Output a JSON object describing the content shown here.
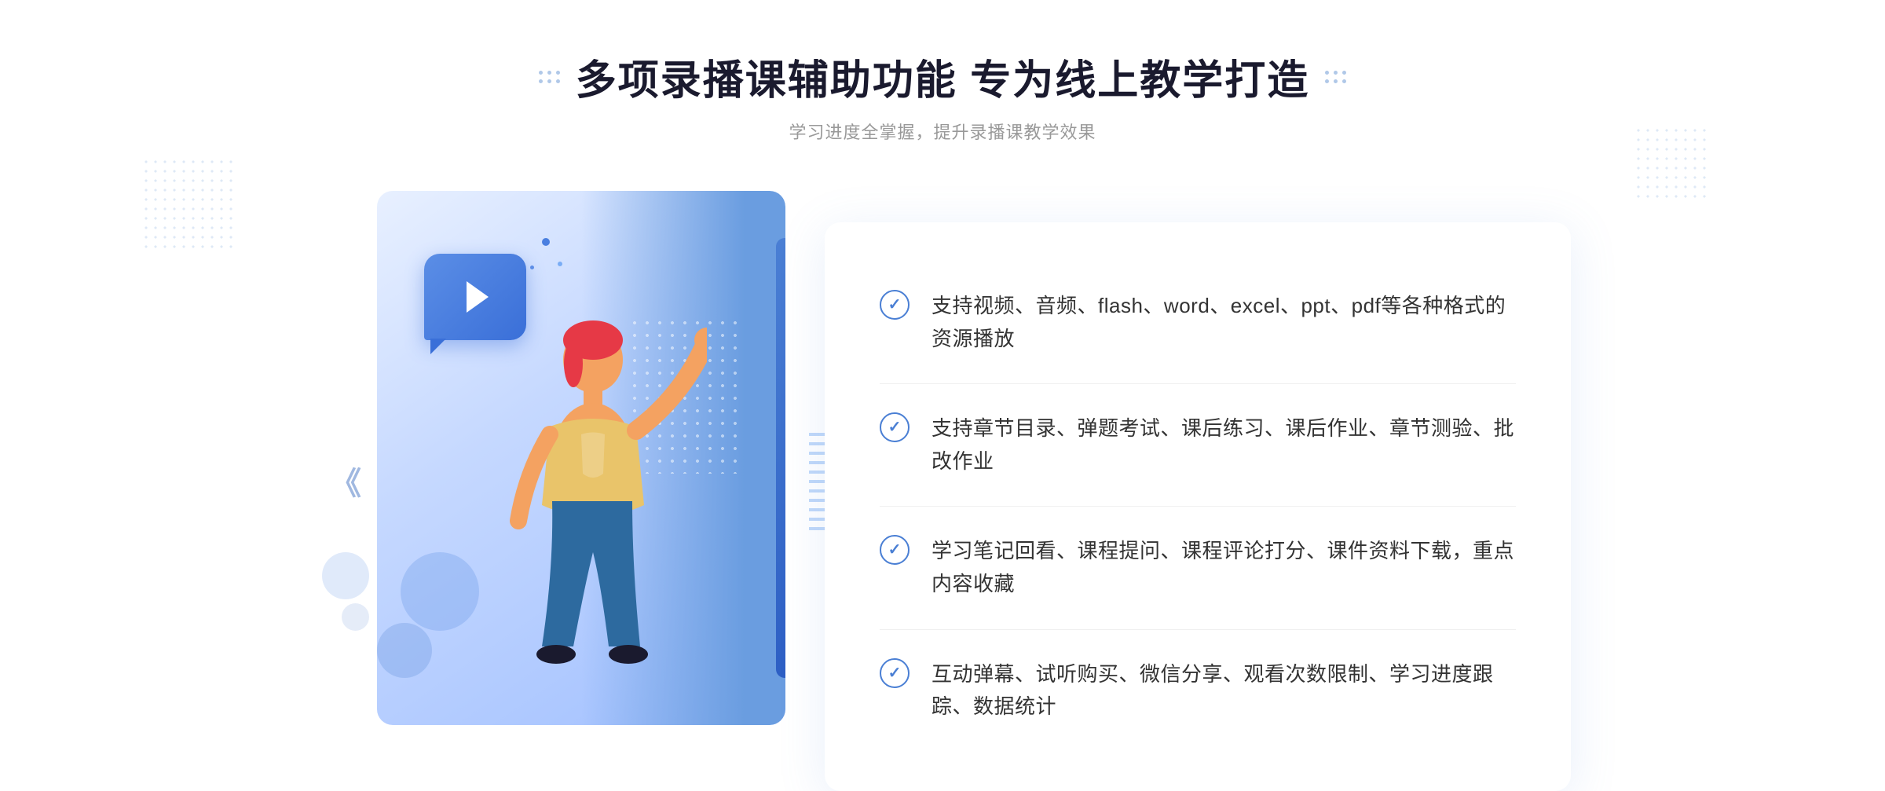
{
  "header": {
    "title": "多项录播课辅助功能 专为线上教学打造",
    "subtitle": "学习进度全掌握，提升录播课教学效果"
  },
  "features": [
    {
      "id": 1,
      "text": "支持视频、音频、flash、word、excel、ppt、pdf等各种格式的资源播放"
    },
    {
      "id": 2,
      "text": "支持章节目录、弹题考试、课后练习、课后作业、章节测验、批改作业"
    },
    {
      "id": 3,
      "text": "学习笔记回看、课程提问、课程评论打分、课件资料下载，重点内容收藏"
    },
    {
      "id": 4,
      "text": "互动弹幕、试听购买、微信分享、观看次数限制、学习进度跟踪、数据统计"
    }
  ],
  "icons": {
    "check": "✓",
    "play": "▶",
    "chevron_left": "《",
    "dots_decorator": "∷"
  },
  "colors": {
    "primary_blue": "#4a7fd4",
    "light_blue": "#e8f0ff",
    "text_dark": "#1a1a2e",
    "text_gray": "#999999",
    "text_body": "#333333"
  }
}
